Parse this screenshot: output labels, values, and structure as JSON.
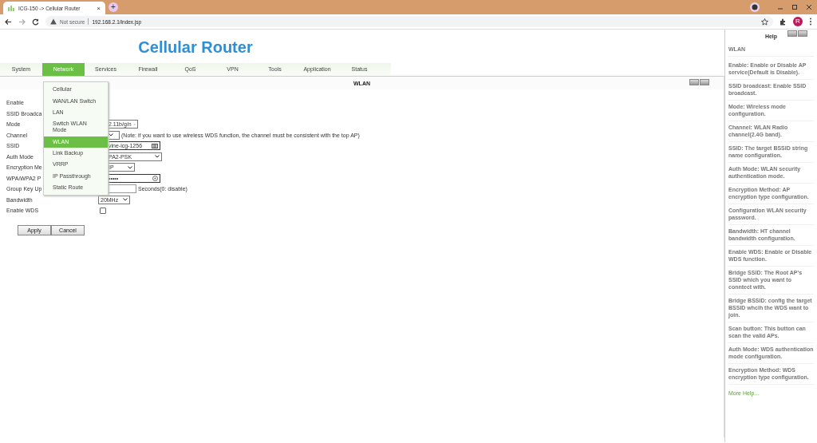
{
  "browser": {
    "tab_title": "ICG-150 -> Cellular Router",
    "tab_close": "×",
    "new_tab": "+",
    "security": "Not secure",
    "url": "192.168.2.1/index.jsp",
    "avatar": "R"
  },
  "header": {
    "title": "Cellular Router"
  },
  "nav": [
    {
      "label": "System",
      "selected": false
    },
    {
      "label": "Network",
      "selected": true
    },
    {
      "label": "Services",
      "selected": false
    },
    {
      "label": "Firewall",
      "selected": false
    },
    {
      "label": "QoS",
      "selected": false
    },
    {
      "label": "VPN",
      "selected": false
    },
    {
      "label": "Tools",
      "selected": false
    },
    {
      "label": "Application",
      "selected": false
    },
    {
      "label": "Status",
      "selected": false
    }
  ],
  "menu": [
    {
      "label": "Cellular",
      "selected": false
    },
    {
      "label": "WAN/LAN Switch",
      "selected": false
    },
    {
      "label": "LAN",
      "selected": false
    },
    {
      "label": "Switch WLAN Mode",
      "selected": false
    },
    {
      "label": "WLAN",
      "selected": true
    },
    {
      "label": "Link Backup",
      "selected": false
    },
    {
      "label": "VRRP",
      "selected": false
    },
    {
      "label": "IP Passthrough",
      "selected": false
    },
    {
      "label": "Static Route",
      "selected": false
    }
  ],
  "panel": {
    "title": "WLAN"
  },
  "form": [
    {
      "label": "Enable",
      "kind": "none"
    },
    {
      "label": "SSID Broadca",
      "kind": "none"
    },
    {
      "label": "Mode",
      "kind": "select",
      "value": "2.11b/g/n"
    },
    {
      "label": "Channel",
      "kind": "select",
      "note": "(Note: if you want to use wireless WDS function, the channel must be consistent with the top AP)"
    },
    {
      "label": "SSID",
      "kind": "text",
      "value": "vine-icg-1256"
    },
    {
      "label": "Auth Mode",
      "kind": "select",
      "value": "PA2-PSK"
    },
    {
      "label": "Encryption Me",
      "kind": "select",
      "value": "IP"
    },
    {
      "label": "WPA/WPA2 P",
      "kind": "password",
      "value": "•••••"
    },
    {
      "label": "Group Key Up",
      "kind": "input",
      "note": "Seconds(0: disable)"
    },
    {
      "label": "Bandwidth",
      "kind": "select",
      "value": "20MHz"
    },
    {
      "label": "Enable WDS",
      "kind": "checkbox",
      "checked": false
    }
  ],
  "buttons": [
    "Apply",
    "Cancel"
  ],
  "help": {
    "title": "Help",
    "heading": "WLAN",
    "items": [
      "Enable: Enable or Disable AP service(Default is Disable).",
      "SSID broadcast: Enable SSID broadcast.",
      "Mode: Wireless mode configuration.",
      "Channel: WLAN Radio channel(2.4G band).",
      "SSID: The target BSSID string name configuration.",
      "Auth Mode: WLAN security authentication mode.",
      "Encryption Method: AP encryption type configuration.",
      "Configuration WLAN security password.",
      "Bandwidth: HT channel bandwidth configuration.",
      "Enable WDS: Enable or Disable WDS function.",
      "Bridge SSID: The Root AP's SSID which you want to conntect with.",
      "Bridge BSSID: config the target BSSID whcih the WDS want to join.",
      "Scan button: This button can scan the valid APs.",
      "Auth Mode: WDS authentication mode configuration.",
      "Encryption Method: WDS encryption type configuration."
    ],
    "more": "More Help..."
  }
}
